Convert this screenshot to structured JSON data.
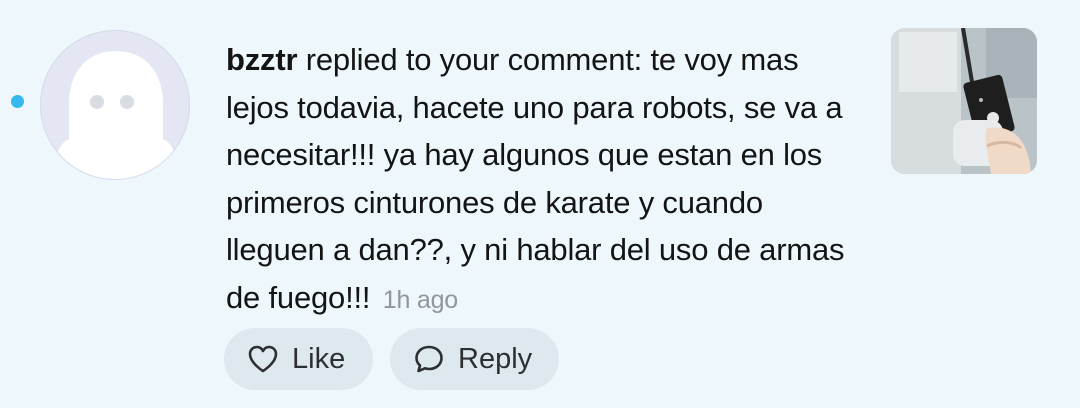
{
  "notification": {
    "unread": true,
    "username": "bzztr",
    "action_text": " replied to your comment: te voy mas lejos todavia, hacete uno para robots, se va a necesitar!!! ya hay algunos que estan en los primeros cinturones de karate y cuando lleguen a dan??, y ni hablar del uso de armas de fuego!!!",
    "timestamp": "1h ago",
    "avatar_icon": "ghost-avatar-icon",
    "thumbnail_description": "hand-holding-device-thumbnail"
  },
  "actions": {
    "like_label": "Like",
    "reply_label": "Reply",
    "like_icon": "heart-icon",
    "reply_icon": "speech-bubble-icon"
  },
  "colors": {
    "background": "#eef8fc",
    "unread_dot": "#35b8ee",
    "button_bg": "#dde9ee",
    "timestamp": "#8f969c"
  }
}
